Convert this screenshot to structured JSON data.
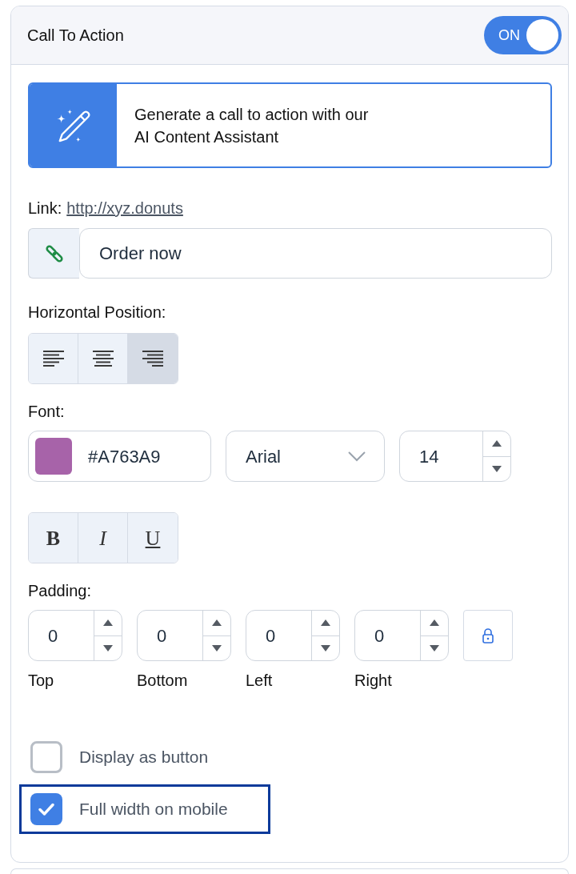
{
  "panel": {
    "title": "Call To Action",
    "toggle": {
      "label": "ON",
      "on": true
    }
  },
  "ai_banner": {
    "text": "Generate a call to action with our\nAI Content Assistant"
  },
  "link": {
    "label": "Link:",
    "url": "http://xyz.donuts",
    "button_text": "Order now"
  },
  "horizontal_position": {
    "label": "Horizontal Position:",
    "options": [
      {
        "kind": "left",
        "selected": false
      },
      {
        "kind": "center",
        "selected": false
      },
      {
        "kind": "right",
        "selected": true
      }
    ]
  },
  "font": {
    "label": "Font:",
    "color": "#A763A9",
    "family": "Arial",
    "size": "14",
    "styles": [
      {
        "label": "B",
        "kind": "bold",
        "selected": false
      },
      {
        "label": "I",
        "kind": "italic",
        "selected": false
      },
      {
        "label": "U",
        "kind": "underline",
        "selected": false
      }
    ]
  },
  "padding": {
    "label": "Padding:",
    "fields": [
      {
        "label": "Top",
        "value": "0"
      },
      {
        "label": "Bottom",
        "value": "0"
      },
      {
        "label": "Left",
        "value": "0"
      },
      {
        "label": "Right",
        "value": "0"
      }
    ]
  },
  "checkboxes": [
    {
      "label": "Display as button",
      "checked": false,
      "focused": false
    },
    {
      "label": "Full width on mobile",
      "checked": true,
      "focused": true
    }
  ]
}
